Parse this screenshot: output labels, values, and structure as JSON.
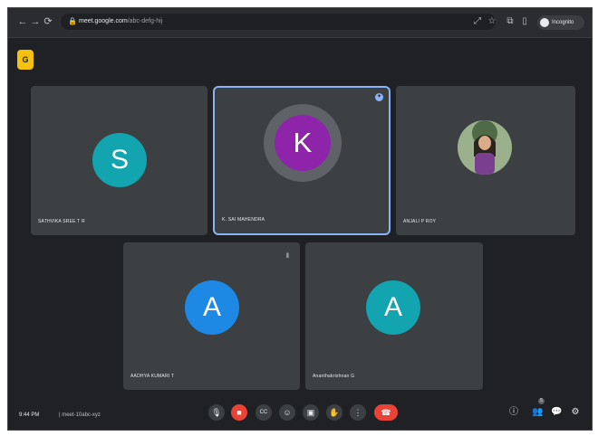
{
  "browser": {
    "url": "meet.google.com",
    "url_extra": "/abc-defg-hij",
    "profile_label": "Incognito",
    "icons": {
      "back": "←",
      "forward": "→",
      "reload": "⟳",
      "lock": "🔒",
      "cast": "⤢",
      "star": "☆",
      "extension": "⧉",
      "sidebar": "▯"
    }
  },
  "app_badge": {
    "label": "G",
    "color": "#f4c20d"
  },
  "participants": [
    {
      "initial": "S",
      "name": "SATHVIKA SREE T R",
      "color": "#12a4af"
    },
    {
      "initial": "K",
      "name": "K. SAI MAHENDRA",
      "color": "#8e24aa",
      "active": true
    },
    {
      "initial": "",
      "name": "ANJALI P ROY",
      "color": "#6a8f5f"
    },
    {
      "initial": "A",
      "name": "AADHYA KUMARI T",
      "color": "#1e88e5"
    },
    {
      "initial": "A",
      "name": "Ananthakrishnan G",
      "color": "#12a4af"
    }
  ],
  "bottom": {
    "time": "9:44 PM",
    "meeting_code": "| meet-10abc-xyz",
    "controls": {
      "mic": "🎙",
      "camera": "■",
      "captions": "CC",
      "emoji": "☺",
      "present": "▣",
      "raise_hand": "✋",
      "more": "⋮",
      "hangup": "☎"
    },
    "right": {
      "info": "ⓘ",
      "people": "👥",
      "chat": "💬",
      "activities": "⚙"
    },
    "people_count": "5"
  }
}
